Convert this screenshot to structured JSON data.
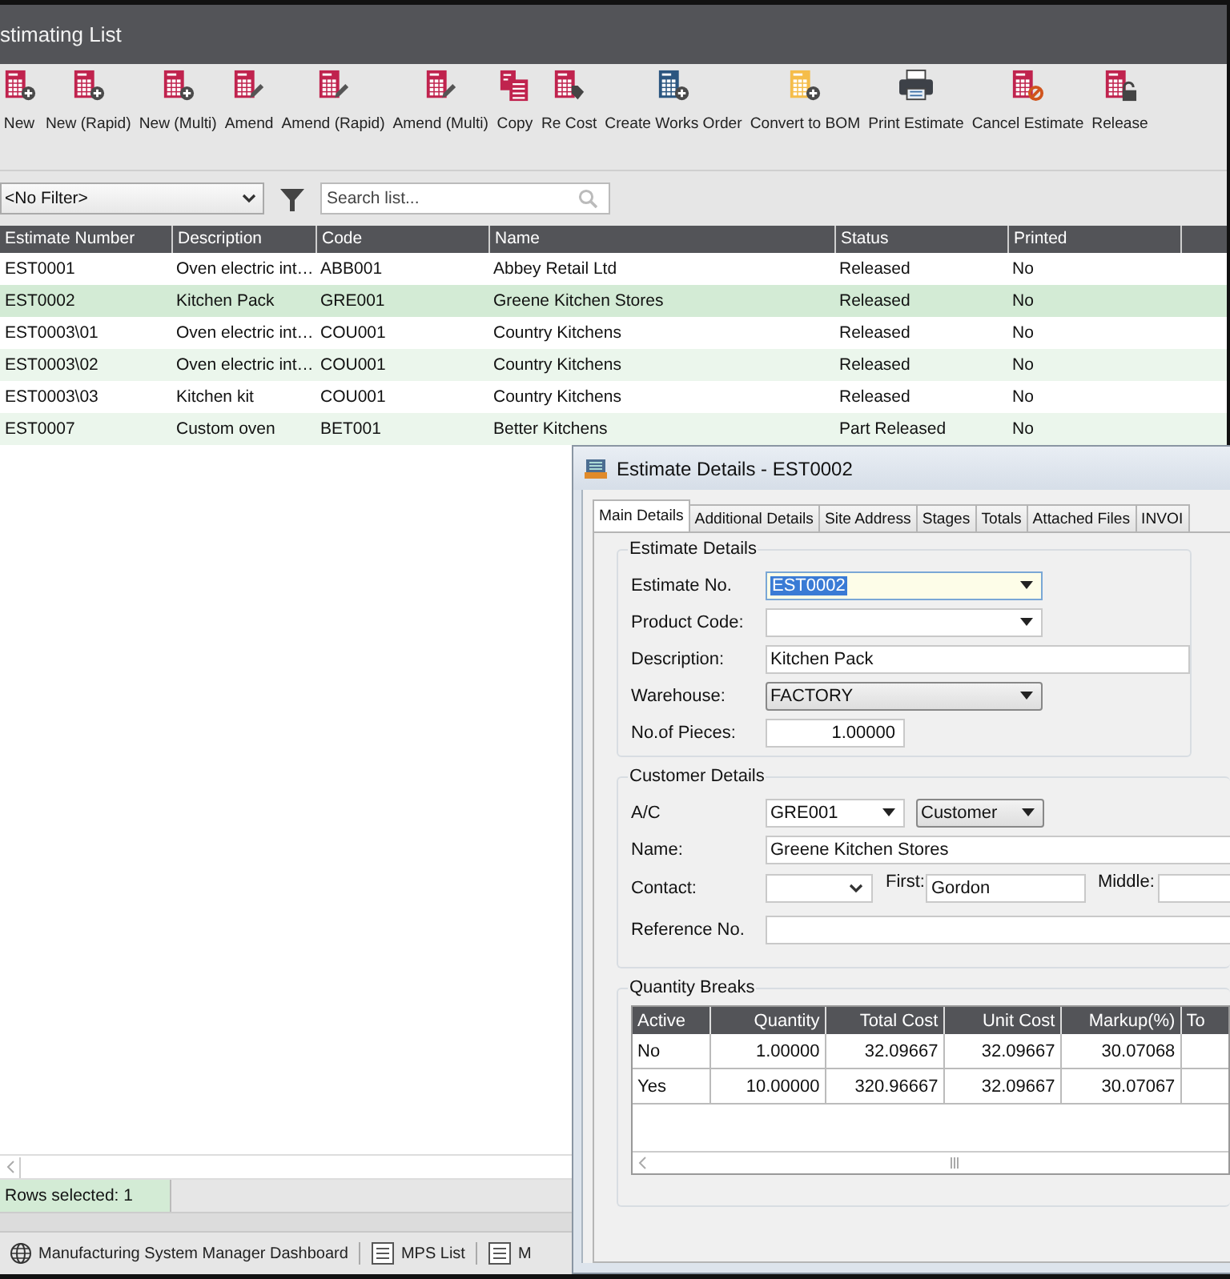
{
  "window": {
    "title": "stimating List"
  },
  "toolbar": [
    {
      "label": "New"
    },
    {
      "label": "New (Rapid)"
    },
    {
      "label": "New (Multi)"
    },
    {
      "label": "Amend"
    },
    {
      "label": "Amend (Rapid)"
    },
    {
      "label": "Amend (Multi)"
    },
    {
      "label": "Copy"
    },
    {
      "label": "Re Cost"
    },
    {
      "label": "Create Works Order"
    },
    {
      "label": "Convert to BOM"
    },
    {
      "label": "Print Estimate"
    },
    {
      "label": "Cancel Estimate"
    },
    {
      "label": "Release"
    }
  ],
  "filter": {
    "value": "<No Filter>"
  },
  "search": {
    "placeholder": "Search list..."
  },
  "table": {
    "columns": [
      "Estimate Number",
      "Description",
      "Code",
      "Name",
      "Status",
      "Printed"
    ],
    "rows": [
      {
        "cells": [
          "EST0001",
          "Oven electric int…",
          "ABB001",
          "Abbey Retail Ltd",
          "Released",
          "No"
        ],
        "selected": false
      },
      {
        "cells": [
          "EST0002",
          "Kitchen Pack",
          "GRE001",
          "Greene Kitchen Stores",
          "Released",
          "No"
        ],
        "selected": true
      },
      {
        "cells": [
          "EST0003\\01",
          "Oven electric int…",
          "COU001",
          "Country Kitchens",
          "Released",
          "No"
        ],
        "selected": false
      },
      {
        "cells": [
          "EST0003\\02",
          "Oven electric int…",
          "COU001",
          "Country Kitchens",
          "Released",
          "No"
        ],
        "selected": false
      },
      {
        "cells": [
          "EST0003\\03",
          "Kitchen kit",
          "COU001",
          "Country Kitchens",
          "Released",
          "No"
        ],
        "selected": false
      },
      {
        "cells": [
          "EST0007",
          "Custom oven",
          "BET001",
          "Better Kitchens",
          "Part Released",
          "No"
        ],
        "selected": false
      }
    ]
  },
  "status_bar": {
    "rows_selected": "Rows selected: 1"
  },
  "taskbar": [
    {
      "label": "Manufacturing System Manager Dashboard"
    },
    {
      "label": "MPS List"
    },
    {
      "label": "M"
    }
  ],
  "dialog": {
    "title": "Estimate Details - EST0002",
    "tabs": [
      {
        "label": "Main Details",
        "selected": true
      },
      {
        "label": "Additional Details",
        "selected": false
      },
      {
        "label": "Site Address",
        "selected": false
      },
      {
        "label": "Stages",
        "selected": false
      },
      {
        "label": "Totals",
        "selected": false
      },
      {
        "label": "Attached Files",
        "selected": false
      },
      {
        "label": "INVOI",
        "selected": false
      }
    ],
    "estimate_details": {
      "legend": "Estimate Details",
      "fields": [
        {
          "label": "Estimate No.",
          "value": "EST0002",
          "kind": "combo",
          "focused": true
        },
        {
          "label": "Product Code:",
          "kind": "combo",
          "focused": false
        },
        {
          "label": "Description:",
          "value": "Kitchen Pack",
          "kind": "text",
          "focused": false
        },
        {
          "label": "Warehouse:",
          "value": "FACTORY",
          "kind": "select",
          "focused": false
        },
        {
          "label": "No.of Pieces:",
          "value": "1.00000",
          "kind": "number",
          "focused": false
        }
      ]
    },
    "customer_details": {
      "legend": "Customer Details",
      "account": {
        "label": "A/C",
        "value": "GRE001",
        "type": "Customer"
      },
      "name": {
        "label": "Name:",
        "value": "Greene Kitchen Stores"
      },
      "contact": {
        "label": "Contact:",
        "first_label": "First:",
        "first": "Gordon",
        "middle_label": "Middle:"
      },
      "reference": {
        "label": "Reference No."
      }
    },
    "quantity_breaks": {
      "legend": "Quantity Breaks",
      "columns": [
        "Active",
        "Quantity",
        "Total Cost",
        "Unit Cost",
        "Markup(%)",
        "To"
      ],
      "rows": [
        [
          "No",
          "1.00000",
          "32.09667",
          "32.09667",
          "30.07068"
        ],
        [
          "Yes",
          "10.00000",
          "320.96667",
          "32.09667",
          "30.07067"
        ]
      ]
    }
  }
}
